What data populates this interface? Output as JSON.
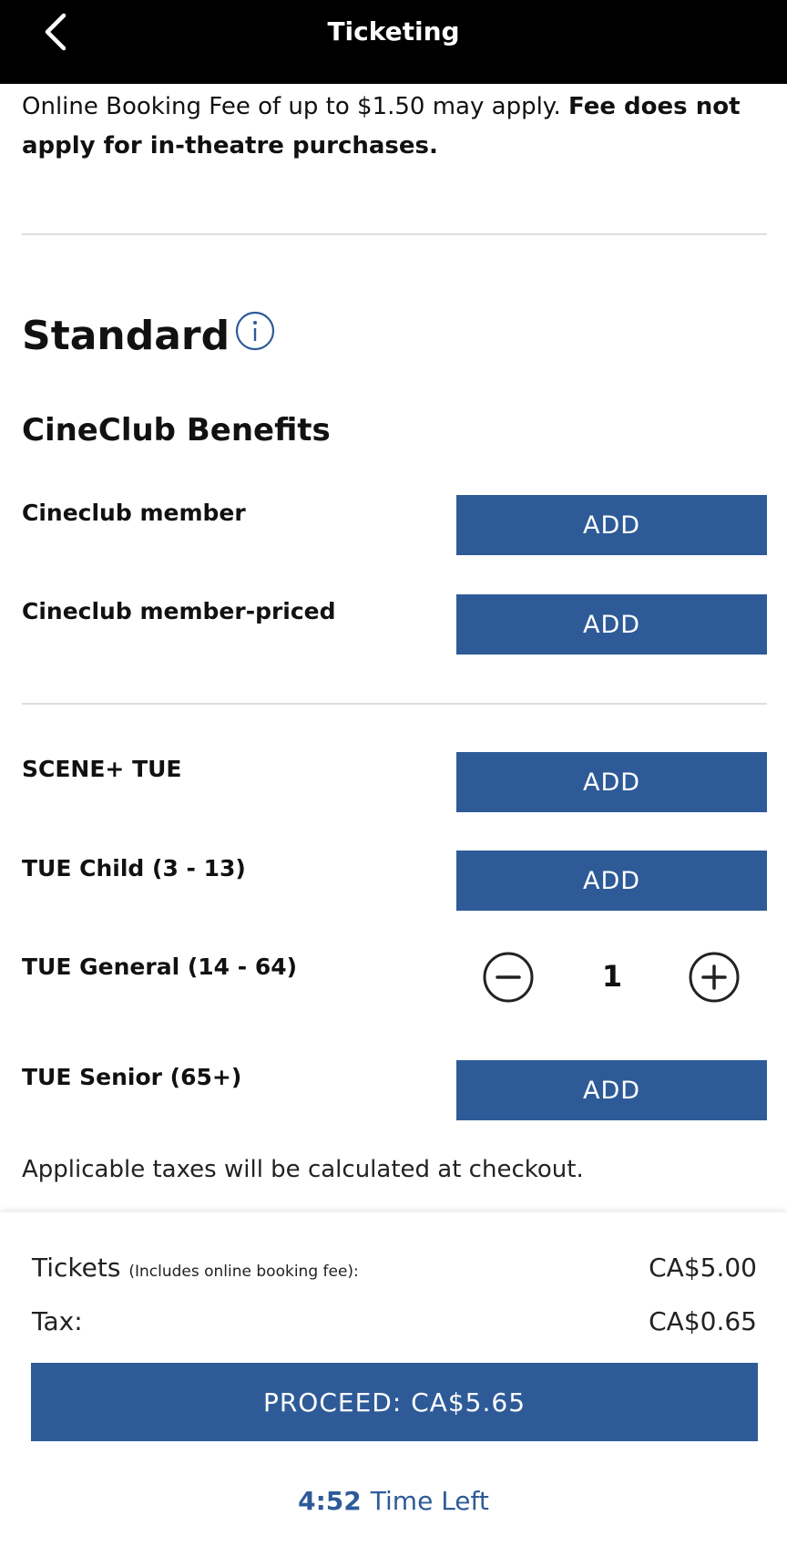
{
  "header": {
    "title": "Ticketing",
    "back_icon": "chevron-left-icon"
  },
  "fee_note": {
    "normal": "Online Booking Fee of up to $1.50 may apply. ",
    "bold": "Fee does not apply for in-theatre purchases."
  },
  "section": {
    "title": "Standard",
    "info_icon": "info-icon"
  },
  "cineclub": {
    "title": "CineClub Benefits",
    "items": [
      {
        "label": "Cineclub member",
        "button": "ADD"
      },
      {
        "label": "Cineclub member-priced",
        "button": "ADD"
      }
    ]
  },
  "tickets": {
    "items": [
      {
        "label": "SCENE+ TUE",
        "button": "ADD"
      },
      {
        "label": "TUE Child (3 - 13)",
        "button": "ADD"
      },
      {
        "label": "TUE General (14 - 64)",
        "quantity": "1"
      },
      {
        "label": "TUE Senior (65+)",
        "button": "ADD"
      }
    ]
  },
  "tax_note": "Applicable taxes will be calculated at checkout.",
  "summary": {
    "tickets_label": "Tickets",
    "tickets_sub": "(Includes online booking fee):",
    "tickets_value": "CA$5.00",
    "tax_label": "Tax:",
    "tax_value": "CA$0.65",
    "proceed_label": "PROCEED: CA$5.65",
    "time_value": "4:52",
    "time_label": "Time Left"
  },
  "colors": {
    "accent": "#2e5b98",
    "header_bg": "#000000"
  }
}
